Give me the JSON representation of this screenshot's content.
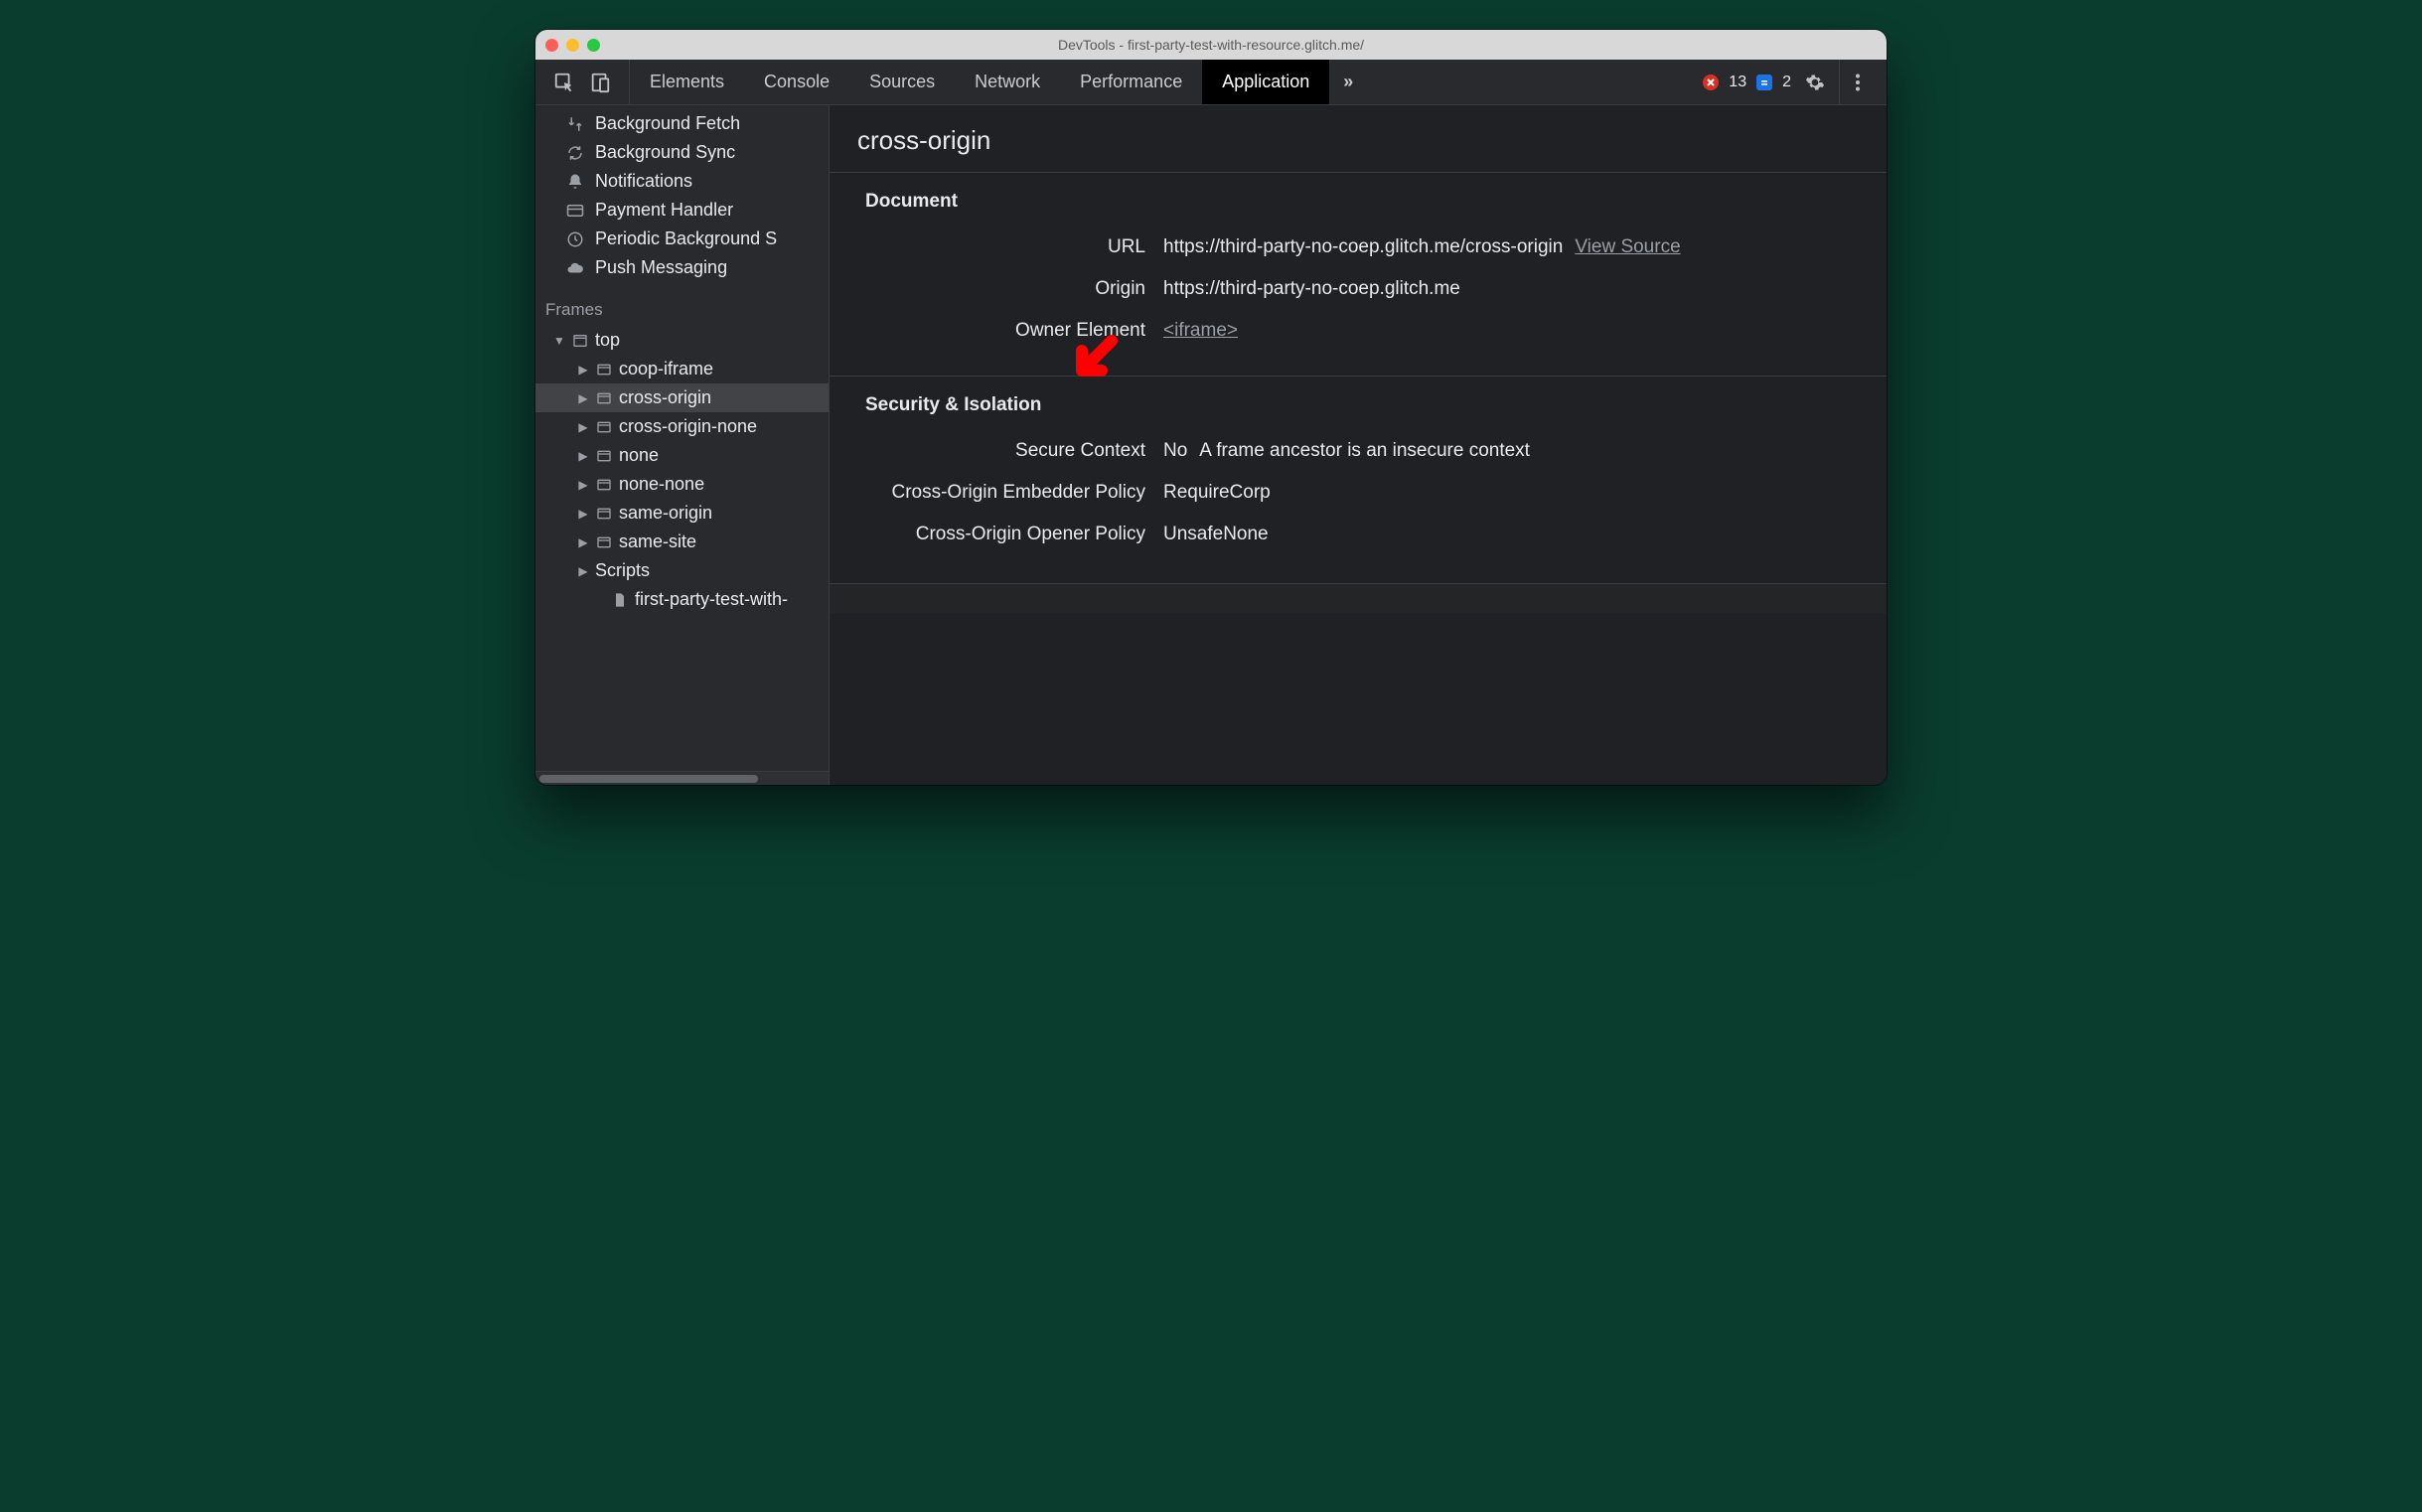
{
  "window": {
    "title": "DevTools - first-party-test-with-resource.glitch.me/"
  },
  "tabs": {
    "items": [
      "Elements",
      "Console",
      "Sources",
      "Network",
      "Performance",
      "Application"
    ],
    "active_index": 5,
    "overflow_glyph": "»"
  },
  "status": {
    "error_count": "13",
    "info_count": "2"
  },
  "sidebar": {
    "bgservices": [
      {
        "icon": "swap-icon",
        "label": "Background Fetch"
      },
      {
        "icon": "sync-icon",
        "label": "Background Sync"
      },
      {
        "icon": "bell-icon",
        "label": "Notifications"
      },
      {
        "icon": "card-icon",
        "label": "Payment Handler"
      },
      {
        "icon": "clock-icon",
        "label": "Periodic Background S"
      },
      {
        "icon": "cloud-icon",
        "label": "Push Messaging"
      }
    ],
    "frames_header": "Frames",
    "tree": [
      {
        "depth": 1,
        "arrow": "down",
        "icon": "window-icon",
        "label": "top",
        "selected": false
      },
      {
        "depth": 2,
        "arrow": "right",
        "icon": "frame-icon",
        "label": "coop-iframe",
        "selected": false
      },
      {
        "depth": 2,
        "arrow": "right",
        "icon": "frame-icon",
        "label": "cross-origin",
        "selected": true
      },
      {
        "depth": 2,
        "arrow": "right",
        "icon": "frame-icon",
        "label": "cross-origin-none",
        "selected": false
      },
      {
        "depth": 2,
        "arrow": "right",
        "icon": "frame-icon",
        "label": "none",
        "selected": false
      },
      {
        "depth": 2,
        "arrow": "right",
        "icon": "frame-icon",
        "label": "none-none",
        "selected": false
      },
      {
        "depth": 2,
        "arrow": "right",
        "icon": "frame-icon",
        "label": "same-origin",
        "selected": false
      },
      {
        "depth": 2,
        "arrow": "right",
        "icon": "frame-icon",
        "label": "same-site",
        "selected": false
      },
      {
        "depth": 2,
        "arrow": "right",
        "icon": "none",
        "label": "Scripts",
        "selected": false
      },
      {
        "depth": 3,
        "arrow": "none",
        "icon": "file-icon",
        "label": "first-party-test-with-",
        "selected": false
      }
    ]
  },
  "detail": {
    "title": "cross-origin",
    "document": {
      "heading": "Document",
      "url_label": "URL",
      "url_value": "https://third-party-no-coep.glitch.me/cross-origin",
      "view_source": "View Source",
      "origin_label": "Origin",
      "origin_value": "https://third-party-no-coep.glitch.me",
      "owner_label": "Owner Element",
      "owner_value": "<iframe>"
    },
    "security": {
      "heading": "Security & Isolation",
      "secure_context_label": "Secure Context",
      "secure_context_value": "No",
      "secure_context_note": "A frame ancestor is an insecure context",
      "coep_label": "Cross-Origin Embedder Policy",
      "coep_value": "RequireCorp",
      "coop_label": "Cross-Origin Opener Policy",
      "coop_value": "UnsafeNone"
    }
  }
}
